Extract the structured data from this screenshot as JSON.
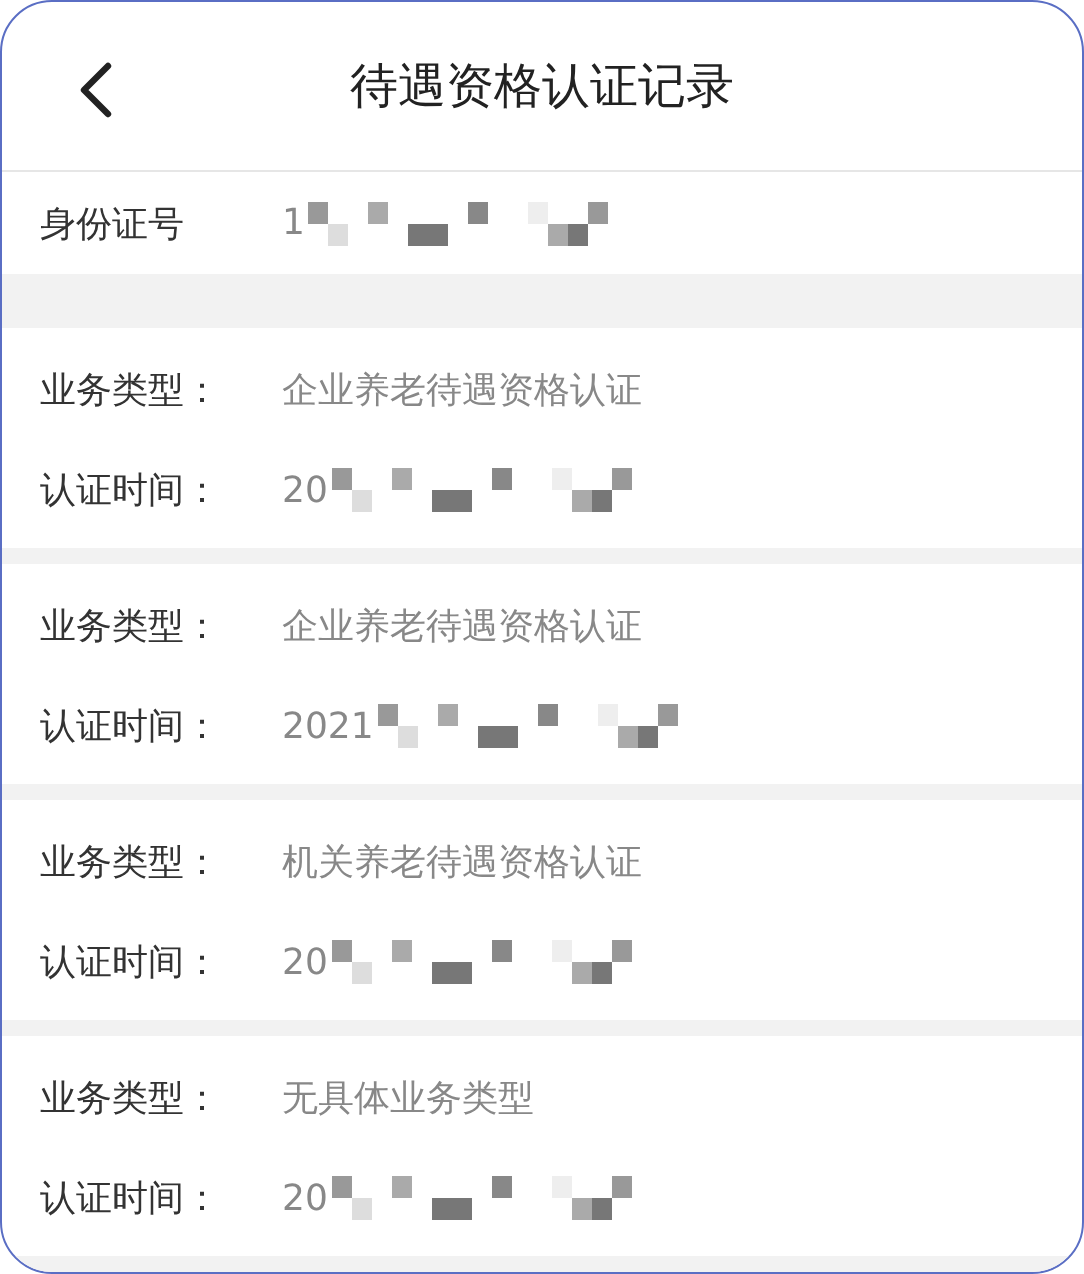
{
  "header": {
    "title": "待遇资格认证记录"
  },
  "id_row": {
    "label": "身份证号",
    "value": "1"
  },
  "records": [
    {
      "type_label": "业务类型：",
      "type_value": "企业养老待遇资格认证",
      "time_label": "认证时间：",
      "time_value": "20"
    },
    {
      "type_label": "业务类型：",
      "type_value": "企业养老待遇资格认证",
      "time_label": "认证时间：",
      "time_value": "2021"
    },
    {
      "type_label": "业务类型：",
      "type_value": "机关养老待遇资格认证",
      "time_label": "认证时间：",
      "time_value": "20"
    },
    {
      "type_label": "业务类型：",
      "type_value": "无具体业务类型",
      "time_label": "认证时间：",
      "time_value": "20"
    }
  ]
}
